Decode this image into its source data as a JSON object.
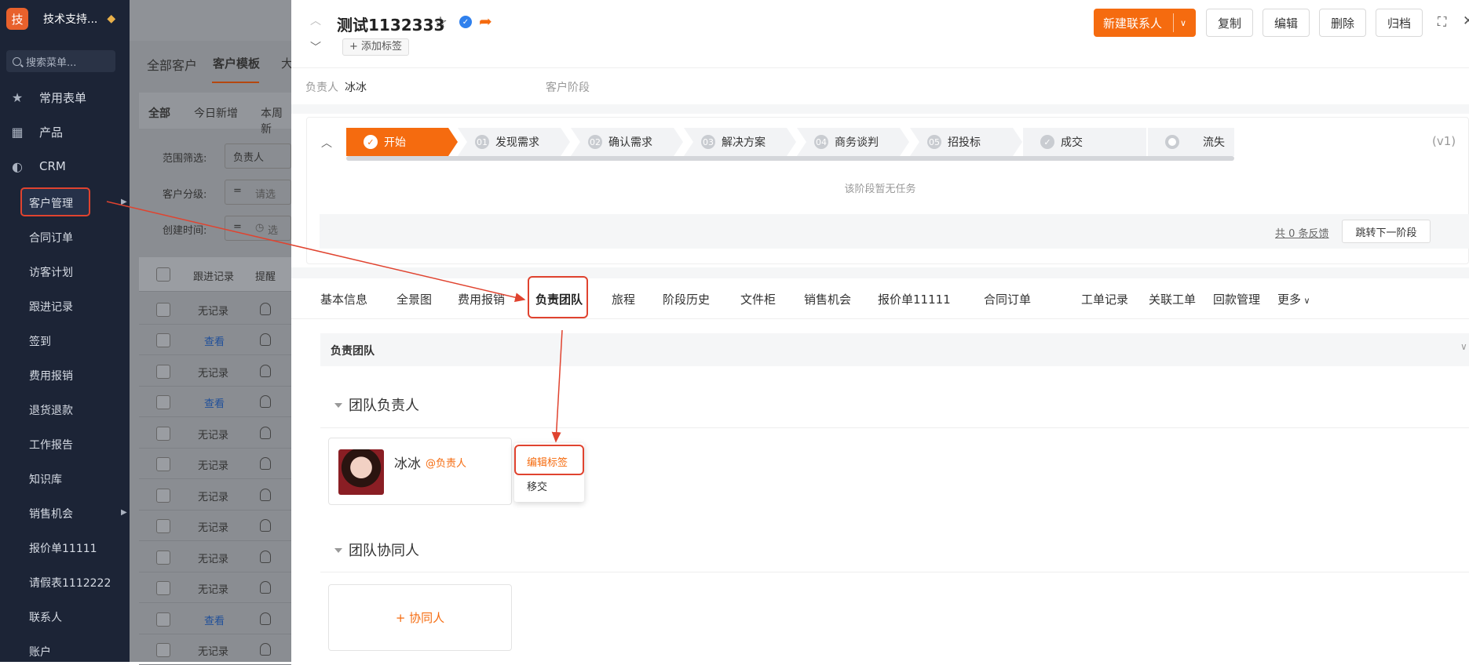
{
  "sidebar": {
    "logo_char": "技",
    "company": "技术支持...",
    "search_placeholder": "搜索菜单...",
    "top_items": [
      {
        "label": "常用表单",
        "icon": "star-icon"
      },
      {
        "label": "产品",
        "icon": "grid-icon"
      },
      {
        "label": "CRM",
        "icon": "crm-icon"
      }
    ],
    "items": [
      "客户管理",
      "合同订单",
      "访客计划",
      "跟进记录",
      "签到",
      "费用报销",
      "退货退款",
      "工作报告",
      "知识库",
      "销售机会",
      "报价单11111",
      "请假表1112222",
      "联系人",
      "账户"
    ]
  },
  "bg": {
    "tabs": [
      "全部客户",
      "客户模板",
      "大"
    ],
    "filter_tabs": [
      "全部",
      "今日新增",
      "本周新"
    ],
    "filters": [
      "范围筛选:",
      "客户分级:",
      "创建时间:"
    ],
    "filter_value": "负责人",
    "filter_eq": "=",
    "filter_placeholder": "请选",
    "filter_date": "选",
    "columns": [
      "跟进记录",
      "提醒"
    ],
    "rows": [
      "无记录",
      "查看",
      "无记录",
      "查看",
      "无记录",
      "无记录",
      "无记录",
      "无记录",
      "无记录",
      "无记录",
      "查看",
      "无记录"
    ]
  },
  "header": {
    "title": "测试1132333",
    "add_tag": "+ 添加标签",
    "buttons": {
      "new_contact": "新建联系人",
      "copy": "复制",
      "edit": "编辑",
      "delete": "删除",
      "archive": "归档"
    }
  },
  "meta": {
    "owner_label": "负责人",
    "owner_value": "冰冰",
    "stage_label": "客户阶段"
  },
  "stages": [
    {
      "num": "",
      "label": "开始"
    },
    {
      "num": "01",
      "label": "发现需求"
    },
    {
      "num": "02",
      "label": "确认需求"
    },
    {
      "num": "03",
      "label": "解决方案"
    },
    {
      "num": "04",
      "label": "商务谈判"
    },
    {
      "num": "05",
      "label": "招投标"
    },
    {
      "num": "",
      "label": "成交"
    },
    {
      "num": "",
      "label": "流失"
    }
  ],
  "stage_version": "(v1)",
  "stage_empty": "该阶段暂无任务",
  "feedback": "共 0 条反馈",
  "next_stage": "跳转下一阶段",
  "tabs": [
    "基本信息",
    "全景图",
    "费用报销",
    "负责团队",
    "旅程",
    "阶段历史",
    "文件柜",
    "销售机会",
    "报价单11111",
    "合同订单",
    "工单记录",
    "关联工单",
    "回款管理",
    "更多"
  ],
  "team": {
    "section_title": "负责团队",
    "leader_title": "团队负责人",
    "leader_name": "冰冰",
    "leader_role": "@负责人",
    "menu_edit": "编辑标签",
    "menu_transfer": "移交",
    "collab_title": "团队协同人",
    "add_collab": "+ 协同人"
  },
  "colors": {
    "accent": "#f56b0f",
    "highlight": "#e0432f",
    "sidebar": "#1c2436"
  }
}
